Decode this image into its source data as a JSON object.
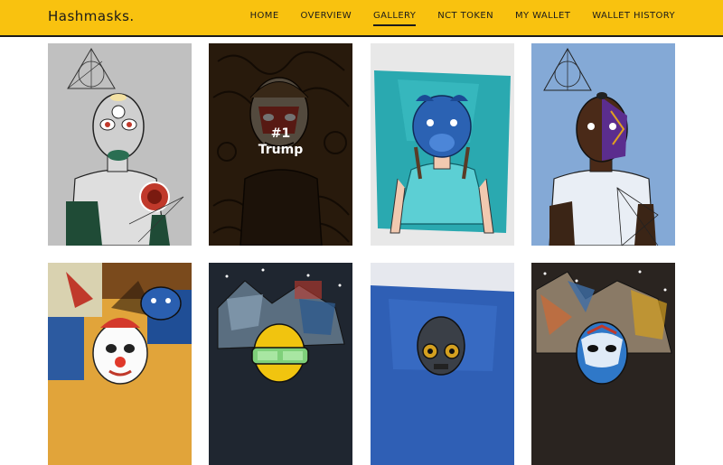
{
  "header": {
    "brand": "Hashmasks.",
    "nav": [
      {
        "label": "HOME"
      },
      {
        "label": "OVERVIEW"
      },
      {
        "label": "GALLERY"
      },
      {
        "label": "NCT TOKEN"
      },
      {
        "label": "MY WALLET"
      },
      {
        "label": "WALLET HISTORY"
      }
    ],
    "active_nav": "GALLERY"
  },
  "gallery": {
    "hover_card": {
      "number": "#1",
      "name": "Trump"
    }
  },
  "colors": {
    "header_bg": "#f9c20f",
    "header_border": "#1b1b1b"
  }
}
